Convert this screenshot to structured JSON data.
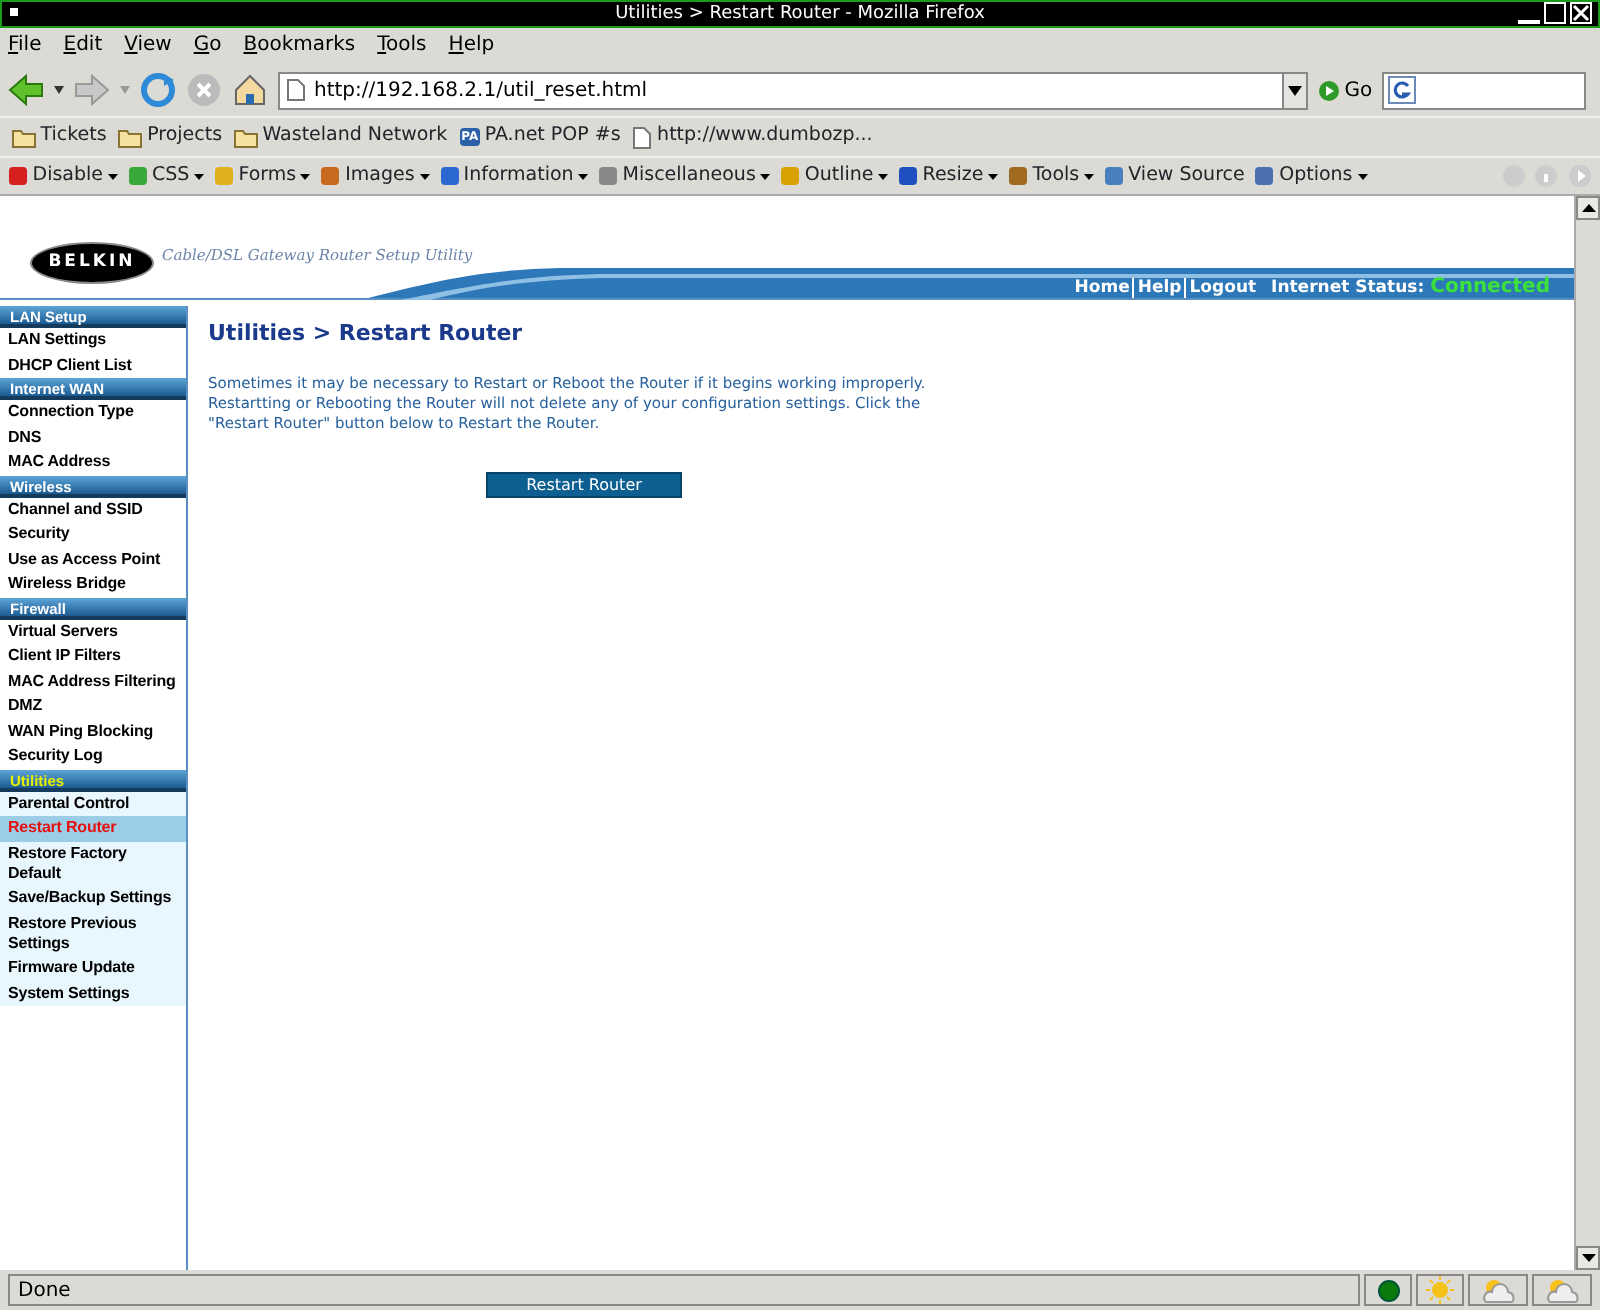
{
  "window": {
    "title": "Utilities > Restart Router - Mozilla Firefox"
  },
  "menu": [
    "File",
    "Edit",
    "View",
    "Go",
    "Bookmarks",
    "Tools",
    "Help"
  ],
  "address": {
    "value": "http://192.168.2.1/util_reset.html",
    "go_label": "Go"
  },
  "bookmarks": [
    {
      "kind": "folder",
      "label": "Tickets"
    },
    {
      "kind": "folder",
      "label": "Projects"
    },
    {
      "kind": "folder",
      "label": "Wasteland Network"
    },
    {
      "kind": "badge",
      "label": "PA.net POP #s",
      "badge": "PA"
    },
    {
      "kind": "page",
      "label": "http://www.dumbozp..."
    }
  ],
  "devtools": [
    {
      "label": "Disable",
      "menu": true
    },
    {
      "label": "CSS",
      "menu": true
    },
    {
      "label": "Forms",
      "menu": true
    },
    {
      "label": "Images",
      "menu": true
    },
    {
      "label": "Information",
      "menu": true
    },
    {
      "label": "Miscellaneous",
      "menu": true
    },
    {
      "label": "Outline",
      "menu": true
    },
    {
      "label": "Resize",
      "menu": true
    },
    {
      "label": "Tools",
      "menu": true
    },
    {
      "label": "View Source",
      "menu": false
    },
    {
      "label": "Options",
      "menu": true
    }
  ],
  "site": {
    "logo": "BELKIN",
    "tagline": "Cable/DSL Gateway Router Setup Utility",
    "links": [
      "Home",
      "Help",
      "Logout"
    ],
    "status_label": "Internet Status:",
    "status_value": "Connected"
  },
  "sidebar": [
    {
      "title": "LAN Setup",
      "selected": false,
      "items": [
        {
          "label": "LAN Settings",
          "selected": false
        },
        {
          "label": "DHCP Client List",
          "selected": false
        }
      ]
    },
    {
      "title": "Internet WAN",
      "selected": false,
      "items": [
        {
          "label": "Connection Type",
          "selected": false
        },
        {
          "label": "DNS",
          "selected": false
        },
        {
          "label": "MAC Address",
          "selected": false
        }
      ]
    },
    {
      "title": "Wireless",
      "selected": false,
      "items": [
        {
          "label": "Channel and SSID",
          "selected": false
        },
        {
          "label": "Security",
          "selected": false
        },
        {
          "label": "Use as Access Point",
          "selected": false
        },
        {
          "label": "Wireless Bridge",
          "selected": false
        }
      ]
    },
    {
      "title": "Firewall",
      "selected": false,
      "items": [
        {
          "label": "Virtual Servers",
          "selected": false
        },
        {
          "label": "Client IP Filters",
          "selected": false
        },
        {
          "label": "MAC Address Filtering",
          "selected": false
        },
        {
          "label": "DMZ",
          "selected": false
        },
        {
          "label": "WAN Ping Blocking",
          "selected": false
        },
        {
          "label": "Security Log",
          "selected": false
        }
      ]
    },
    {
      "title": "Utilities",
      "selected": true,
      "items": [
        {
          "label": "Parental Control",
          "selected": false
        },
        {
          "label": "Restart Router",
          "selected": true
        },
        {
          "label": "Restore Factory Default",
          "selected": false
        },
        {
          "label": "Save/Backup Settings",
          "selected": false
        },
        {
          "label": "Restore Previous Settings",
          "selected": false
        },
        {
          "label": "Firmware Update",
          "selected": false
        },
        {
          "label": "System Settings",
          "selected": false
        }
      ]
    }
  ],
  "main": {
    "heading": "Utilities > Restart Router",
    "text": "Sometimes it may be necessary to Restart or Reboot the Router if it begins working improperly. Restartting or Rebooting the Router will not delete any of your configuration settings. Click the \"Restart Router\" button below to Restart the Router.",
    "button": "Restart Router"
  },
  "status_bar": {
    "text": "Done"
  }
}
